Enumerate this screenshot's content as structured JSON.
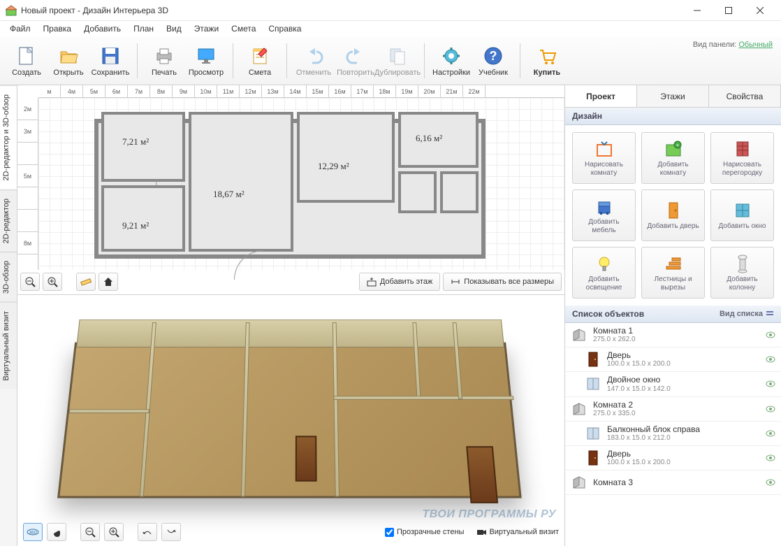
{
  "window": {
    "title": "Новый проект - Дизайн Интерьера 3D"
  },
  "menu": [
    "Файл",
    "Правка",
    "Добавить",
    "План",
    "Вид",
    "Этажи",
    "Смета",
    "Справка"
  ],
  "toolbar": {
    "create": "Создать",
    "open": "Открыть",
    "save": "Сохранить",
    "print": "Печать",
    "preview": "Просмотр",
    "estimate": "Смета",
    "undo": "Отменить",
    "redo": "Повторить",
    "duplicate": "Дублировать",
    "settings": "Настройки",
    "tutorial": "Учебник",
    "buy": "Купить",
    "panel_label": "Вид панели:",
    "panel_mode": "Обычный"
  },
  "side_tabs": [
    "2D-редактор и 3D-обзор",
    "2D-редактор",
    "3D-обзор",
    "Виртуальный визит"
  ],
  "ruler_h": [
    "м",
    "4м",
    "5м",
    "6м",
    "7м",
    "8м",
    "9м",
    "10м",
    "11м",
    "12м",
    "13м",
    "14м",
    "15м",
    "16м",
    "17м",
    "18м",
    "19м",
    "20м",
    "21м",
    "22м"
  ],
  "ruler_v": [
    "2м",
    "3м",
    "",
    "5м",
    "",
    "",
    "8м"
  ],
  "rooms": {
    "r1": "7,21 м²",
    "r2": "18,67 м²",
    "r3": "12,29 м²",
    "r4": "6,16 м²",
    "r5": "9,21 м²"
  },
  "plan_buttons": {
    "add_floor": "Добавить этаж",
    "show_sizes": "Показывать все размеры"
  },
  "view3d": {
    "transparent": "Прозрачные стены",
    "virtual": "Виртуальный визит"
  },
  "rtabs": [
    "Проект",
    "Этажи",
    "Свойства"
  ],
  "sections": {
    "design": "Дизайн",
    "objects": "Список объектов",
    "view_list": "Вид списка"
  },
  "design": [
    "Нарисовать комнату",
    "Добавить комнату",
    "Нарисовать перегородку",
    "Добавить мебель",
    "Добавить дверь",
    "Добавить окно",
    "Добавить освещение",
    "Лестницы и вырезы",
    "Добавить колонну"
  ],
  "objects": [
    {
      "name": "Комната 1",
      "dim": "275.0 x 262.0",
      "type": "room"
    },
    {
      "name": "Дверь",
      "dim": "100.0 x 15.0 x 200.0",
      "type": "door",
      "child": true
    },
    {
      "name": "Двойное окно",
      "dim": "147.0 x 15.0 x 142.0",
      "type": "window",
      "child": true
    },
    {
      "name": "Комната 2",
      "dim": "275.0 x 335.0",
      "type": "room"
    },
    {
      "name": "Балконный блок справа",
      "dim": "183.0 x 15.0 x 212.0",
      "type": "window",
      "child": true
    },
    {
      "name": "Дверь",
      "dim": "100.0 x 15.0 x 200.0",
      "type": "door",
      "child": true
    },
    {
      "name": "Комната 3",
      "dim": "",
      "type": "room"
    }
  ],
  "watermark": "ТВОИ ПРОГРАММЫ РУ"
}
